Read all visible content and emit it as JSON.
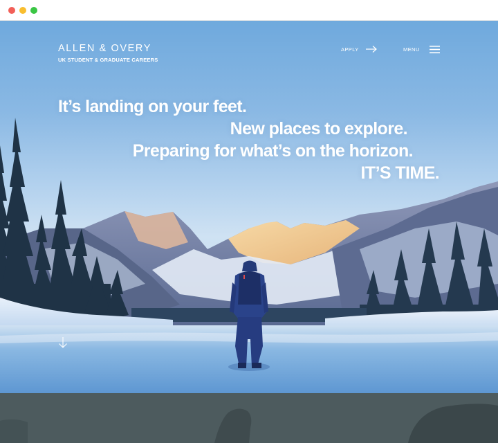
{
  "window": {
    "controls": [
      "close",
      "minimize",
      "maximize"
    ]
  },
  "header": {
    "logo": "ALLEN & OVERY",
    "tagline": "UK STUDENT & GRADUATE CAREERS",
    "apply_label": "APPLY",
    "menu_label": "MENU",
    "apply_icon": "arrow-right-icon",
    "menu_icon": "hamburger-icon"
  },
  "hero": {
    "lines": [
      "It’s landing on your feet.",
      "New places to explore.",
      "Preparing for what’s on the horizon.",
      "IT’S TIME."
    ],
    "scroll_icon": "arrow-down-icon"
  },
  "colors": {
    "text": "#ffffff",
    "sky": "#7fb0dc",
    "section_below": "#4d5b5e"
  }
}
